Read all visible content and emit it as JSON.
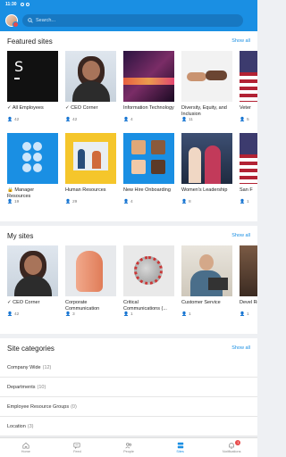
{
  "status": {
    "time": "11:30"
  },
  "search": {
    "placeholder": "Search..."
  },
  "featured": {
    "title": "Featured sites",
    "show_all": "Show all",
    "row1": [
      {
        "name": "All Employees",
        "followed": true,
        "count": "42"
      },
      {
        "name": "CEO Corner",
        "followed": true,
        "count": "42"
      },
      {
        "name": "Information Technology",
        "followed": false,
        "count": "4"
      },
      {
        "name": "Diversity, Equity, and Inclusion",
        "followed": false,
        "count": "11"
      },
      {
        "name": "Veter",
        "followed": false,
        "count": "5"
      }
    ],
    "row2": [
      {
        "name": "Manager Resources",
        "count": "19"
      },
      {
        "name": "Human Resources",
        "count": "29"
      },
      {
        "name": "New Hire Onboarding",
        "count": "4"
      },
      {
        "name": "Women's Leadership",
        "count": "8"
      },
      {
        "name": "San F",
        "count": "1"
      }
    ]
  },
  "my_sites": {
    "title": "My sites",
    "show_all": "Show all",
    "items": [
      {
        "name": "CEO Corner",
        "count": "42"
      },
      {
        "name": "Corporate Communication",
        "count": "3"
      },
      {
        "name": "Critical Communications (...",
        "count": "1"
      },
      {
        "name": "Customer Service",
        "count": "1"
      },
      {
        "name": "Devel Resou",
        "count": "1"
      }
    ]
  },
  "categories": {
    "title": "Site categories",
    "show_all": "Show all",
    "items": [
      {
        "label": "Company Wide",
        "count": "(12)"
      },
      {
        "label": "Departments",
        "count": "(10)"
      },
      {
        "label": "Employee Resource Groups",
        "count": "(0)"
      },
      {
        "label": "Location",
        "count": "(3)"
      }
    ]
  },
  "nav": {
    "items": [
      {
        "label": "Home"
      },
      {
        "label": "Feed"
      },
      {
        "label": "People"
      },
      {
        "label": "Sites"
      },
      {
        "label": "Notifications"
      }
    ],
    "badge": "1"
  },
  "colors": {
    "accent": "#1a8fe3"
  }
}
